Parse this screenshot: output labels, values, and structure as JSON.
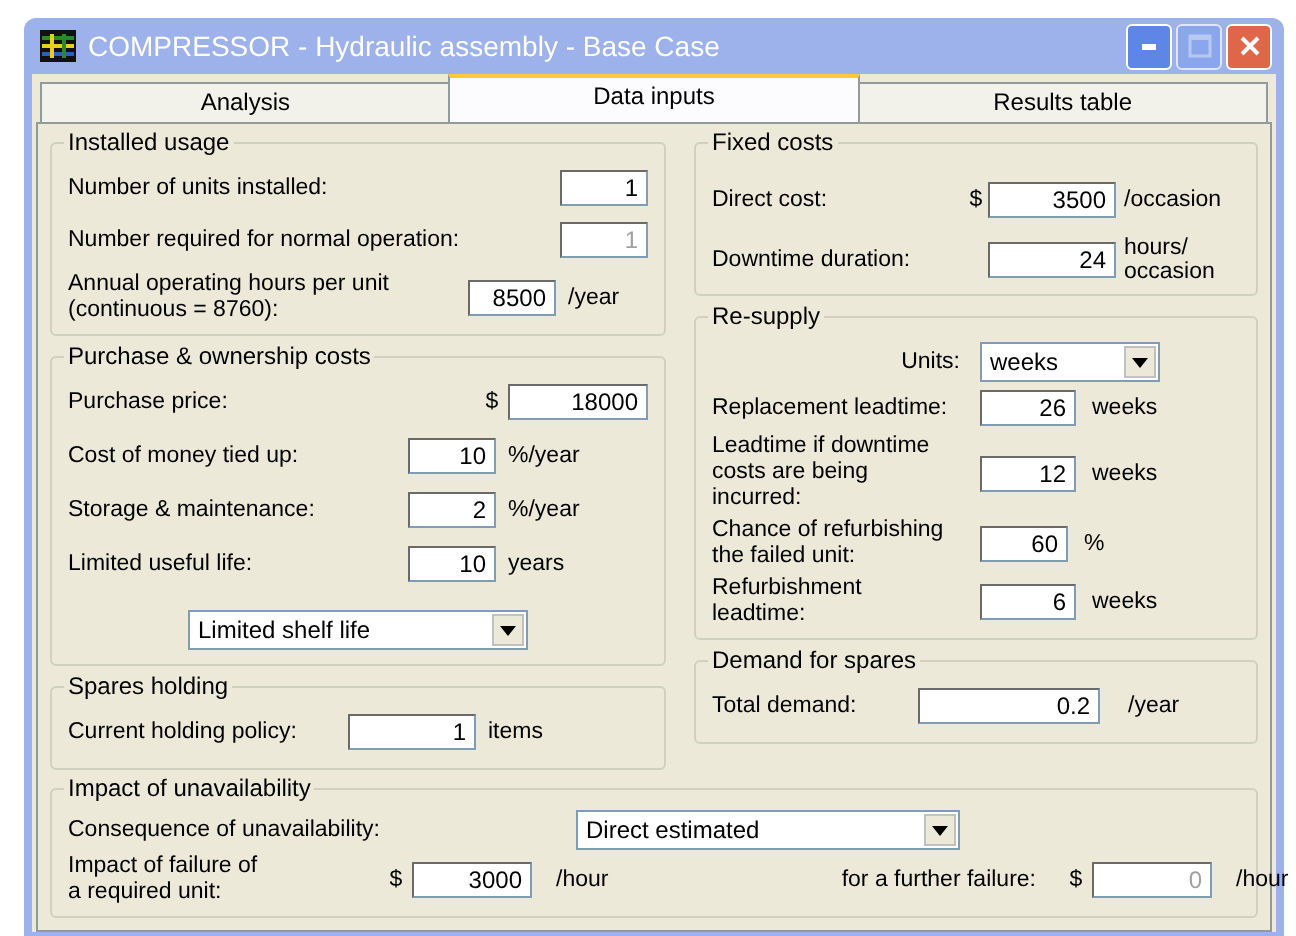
{
  "window": {
    "title": "COMPRESSOR - Hydraulic assembly - Base Case"
  },
  "tabs": [
    {
      "label": "Analysis",
      "selected": false
    },
    {
      "label": "Data inputs",
      "selected": true
    },
    {
      "label": "Results table",
      "selected": false
    }
  ],
  "left_groups": [
    {
      "title": "Installed usage",
      "rows": [
        {
          "kind": "field",
          "label": "Number of units installed:",
          "value": "1",
          "disabled": false
        },
        {
          "kind": "field",
          "label": "Number required for normal operation:",
          "value": "1",
          "disabled": true
        },
        {
          "kind": "field",
          "label": "Annual operating hours per unit\n(continuous = 8760):",
          "value": "8500",
          "unit": "/year",
          "disabled": false
        }
      ]
    },
    {
      "title": "Purchase & ownership costs",
      "rows": [
        {
          "kind": "field",
          "label": "Purchase price:",
          "prefix": "$",
          "value": "18000",
          "disabled": false
        },
        {
          "kind": "field",
          "label": "Cost of money tied up:",
          "value": "10",
          "unit": "%/year",
          "disabled": false
        },
        {
          "kind": "field",
          "label": "Storage & maintenance:",
          "value": "2",
          "unit": "%/year",
          "disabled": false
        },
        {
          "kind": "field",
          "label": "Limited useful life:",
          "value": "10",
          "unit": "years",
          "disabled": false
        },
        {
          "kind": "dropdown",
          "value": "Limited shelf life"
        }
      ]
    },
    {
      "title": "Spares holding",
      "rows": [
        {
          "kind": "field",
          "label": "Current holding policy:",
          "value": "1",
          "unit": "items",
          "disabled": false
        }
      ]
    }
  ],
  "right_groups": [
    {
      "title": "Fixed costs",
      "rows": [
        {
          "kind": "field",
          "label": "Direct cost:",
          "prefix": "$",
          "value": "3500",
          "unit": "/occasion",
          "disabled": false
        },
        {
          "kind": "field",
          "label": "Downtime duration:",
          "value": "24",
          "unit": "hours/\noccasion",
          "disabled": false
        }
      ]
    },
    {
      "title": "Re-supply",
      "rows": [
        {
          "kind": "dropdown",
          "label": "Units:",
          "value": "weeks"
        },
        {
          "kind": "field",
          "label": "Replacement leadtime:",
          "value": "26",
          "unit": "weeks",
          "disabled": false
        },
        {
          "kind": "field",
          "label": "Leadtime if downtime\ncosts are being incurred:",
          "value": "12",
          "unit": "weeks",
          "disabled": false
        },
        {
          "kind": "field",
          "label": "Chance of refurbishing\nthe failed unit:",
          "value": "60",
          "unit": "%",
          "disabled": false
        },
        {
          "kind": "field",
          "label": "Refurbishment leadtime:",
          "value": "6",
          "unit": "weeks",
          "disabled": false
        }
      ]
    },
    {
      "title": "Demand for spares",
      "rows": [
        {
          "kind": "field",
          "label": "Total demand:",
          "value": "0.2",
          "unit": "/year",
          "disabled": false
        }
      ]
    }
  ],
  "bottom_group": {
    "title": "Impact of unavailability",
    "rows": [
      {
        "kind": "dropdown",
        "label": "Consequence of unavailability:",
        "value": "Direct estimated"
      },
      {
        "kind": "pair",
        "fields": [
          {
            "label": "Impact of failure of\na required unit:",
            "prefix": "$",
            "value": "3000",
            "unit": "/hour",
            "disabled": false
          },
          {
            "label": "for a further failure:",
            "prefix": "$",
            "value": "0",
            "unit": "/hour",
            "disabled": true
          }
        ]
      }
    ]
  }
}
